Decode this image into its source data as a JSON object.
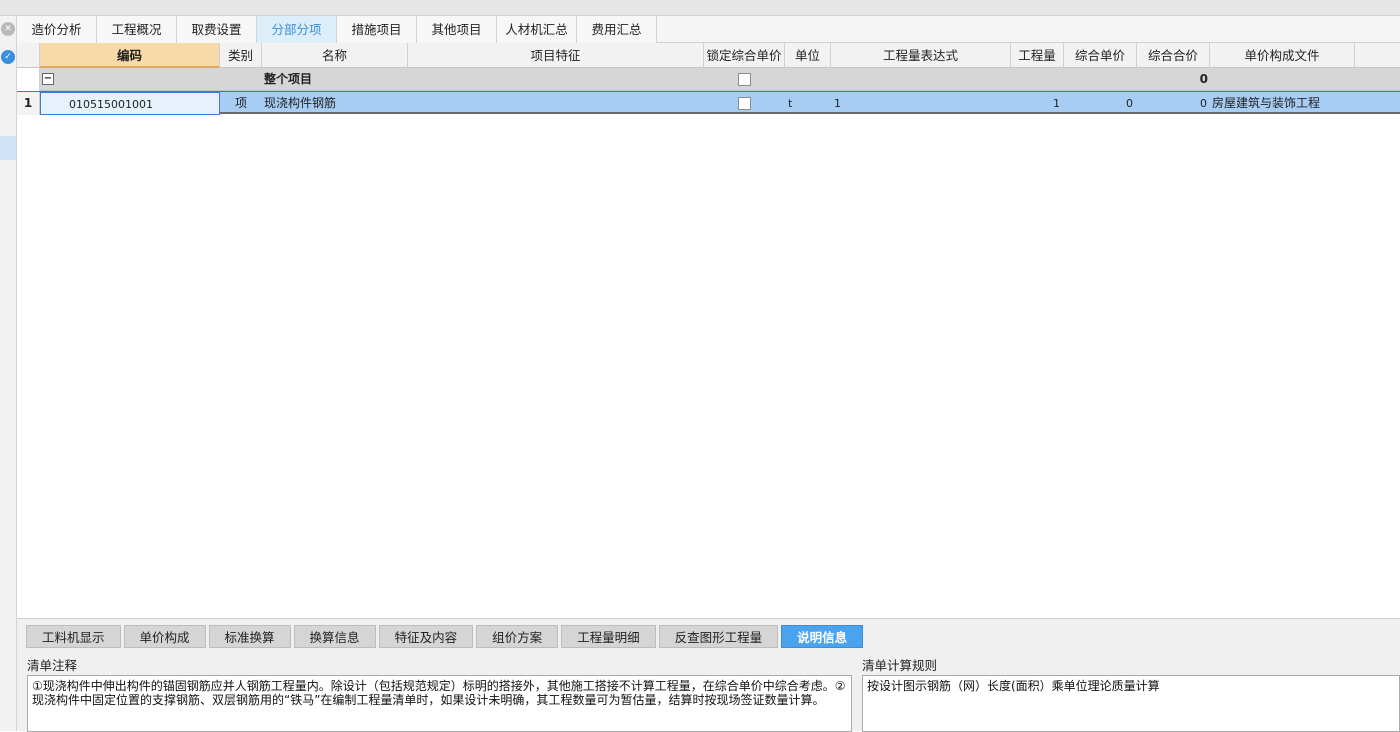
{
  "tabs": [
    "造价分析",
    "工程概况",
    "取费设置",
    "分部分项",
    "措施项目",
    "其他项目",
    "人材机汇总",
    "费用汇总"
  ],
  "columns": {
    "code": "编码",
    "type": "类别",
    "name": "名称",
    "feature": "项目特征",
    "lock": "锁定综合单价",
    "unit": "单位",
    "expr": "工程量表达式",
    "qty": "工程量",
    "unit_price": "综合单价",
    "total_price": "综合合价",
    "file": "单价构成文件"
  },
  "rows": {
    "root": {
      "name": "整个项目",
      "total_price": "0"
    },
    "item1": {
      "no": "1",
      "code": "010515001001",
      "type": "项",
      "name": "现浇构件钢筋",
      "unit": "t",
      "expr": "1",
      "qty": "1",
      "unit_price": "0",
      "total_price": "0",
      "file": "房屋建筑与装饰工程"
    }
  },
  "bottom_tabs": [
    "工料机显示",
    "单价构成",
    "标准换算",
    "换算信息",
    "特征及内容",
    "组价方案",
    "工程量明细",
    "反查图形工程量",
    "说明信息"
  ],
  "bottom_active": "说明信息",
  "notes": {
    "left_label": "清单注释",
    "left_text": "①现浇构件中伸出构件的锚固钢筋应并人钢筋工程量内。除设计（包括规范规定）标明的搭接外，其他施工搭接不计算工程量，在综合单价中综合考虑。②现浇构件中固定位置的支撑钢筋、双层钢筋用的“铁马”在编制工程量清单时，如果设计未明确，其工程数量可为暂估量，结算时按现场签证数量计算。",
    "right_label": "清单计算规则",
    "right_text": "按设计图示钢筋（网）长度(面积）乘单位理论质量计算"
  },
  "colors": {
    "active_tab": "#3d8ed6",
    "selected_row": "#a7cdf4",
    "header_highlight": "#f8d9a8",
    "bottom_active": "#4aa3ec"
  }
}
